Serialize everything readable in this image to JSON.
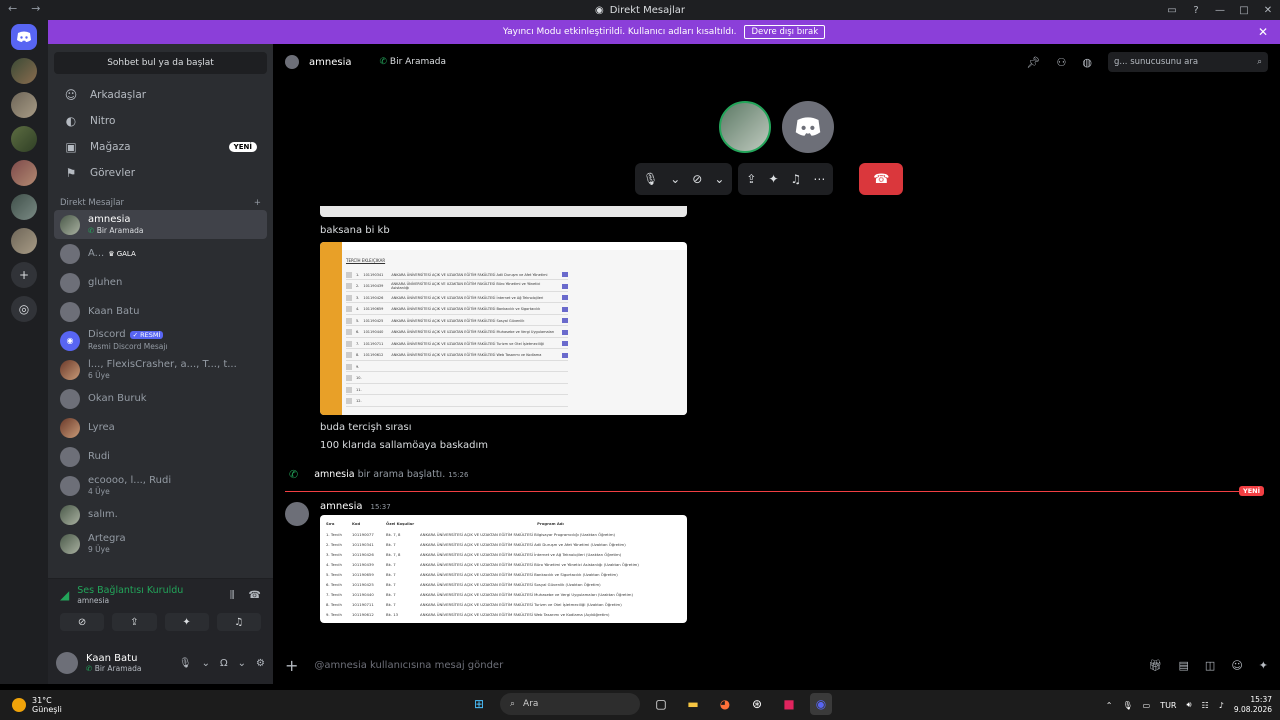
{
  "window": {
    "title": "Direkt Mesajlar",
    "nav_back": "←",
    "nav_forward": "→"
  },
  "banner": {
    "text": "Yayıncı Modu etkinleştirildi. Kullanıcı adları kısaltıldı.",
    "button": "Devre dışı bırak"
  },
  "sidebar": {
    "find_placeholder": "Sohbet bul ya da başlat",
    "nav": [
      {
        "label": "Arkadaşlar",
        "icon": "friends-icon"
      },
      {
        "label": "Nitro",
        "icon": "nitro-icon"
      },
      {
        "label": "Mağaza",
        "icon": "shop-icon",
        "badge": "YENİ"
      },
      {
        "label": "Görevler",
        "icon": "quests-icon"
      }
    ],
    "dm_header": "Direkt Mesajlar",
    "dm_add": "+",
    "dms": [
      {
        "name": "amnesia",
        "sub": "Bir Aramada"
      },
      {
        "name": "A...",
        "tag": "GALA"
      },
      {
        "name": "gluhen"
      },
      {
        "name": "Kaan Batu"
      },
      {
        "name": "Discord",
        "tag": "RESMİ",
        "sub": "Resmi Discord Mesajı"
      },
      {
        "name": "l..., FlexisCrasher, a..., T..., t...",
        "sub": "6 Üye"
      },
      {
        "name": "Okan Buruk"
      },
      {
        "name": "Lyrea"
      },
      {
        "name": "Rudi"
      },
      {
        "name": "ecoooo, l..., Rudi",
        "sub": "4 Üye"
      },
      {
        "name": "salım."
      },
      {
        "name": "Artegra",
        "sub": "9 Üye"
      }
    ]
  },
  "voice": {
    "status": "Ses Bağlantısı Kuruldu",
    "channel": "amnesia"
  },
  "user": {
    "name": "Kaan Batu",
    "status": "Bir Aramada"
  },
  "header": {
    "name": "amnesia",
    "status": "Bir Aramada",
    "search_placeholder": "g... sunucusunu ara"
  },
  "messages": {
    "line1": "baksana bi  kb",
    "line2": "buda tercişh sırası",
    "line3": "100 klarıda sallamöaya baskadım",
    "system_name": "amnesia",
    "system_text": "bir arama başlattı.",
    "system_time": "15:26",
    "new_tag": "YENİ",
    "author": "amnesia",
    "author_time": "15:37"
  },
  "attachment1": {
    "label": "TERCİH EKLE/ÇIKAR",
    "rows": [
      {
        "no": "1.",
        "code": "101190341",
        "text": "ANKARA ÜNİVERSİTESİ AÇIK VE UZAKTAN EĞİTİM FAKÜLTESİ Adli Duruşm ve Afet Yönetimi"
      },
      {
        "no": "2.",
        "code": "101190439",
        "text": "ANKARA ÜNİVERSİTESİ AÇIK VE UZAKTAN EĞİTİM FAKÜLTESİ Büro Yönetimi ve Yönetici Asistanlığı"
      },
      {
        "no": "3.",
        "code": "101190426",
        "text": "ANKARA ÜNİVERSİTESİ AÇIK VE UZAKTAN EĞİTİM FAKÜLTESİ İnternet ve Ağ Teknolojileri"
      },
      {
        "no": "4.",
        "code": "101190659",
        "text": "ANKARA ÜNİVERSİTESİ AÇIK VE UZAKTAN EĞİTİM FAKÜLTESİ Bankacılık ve Sigortacılık"
      },
      {
        "no": "5.",
        "code": "101190425",
        "text": "ANKARA ÜNİVERSİTESİ AÇIK VE UZAKTAN EĞİTİM FAKÜLTESİ Sosyal Güvenlik"
      },
      {
        "no": "6.",
        "code": "101190440",
        "text": "ANKARA ÜNİVERSİTESİ AÇIK VE UZAKTAN EĞİTİM FAKÜLTESİ Muhasebe ve Vergi Uygulamaları"
      },
      {
        "no": "7.",
        "code": "101190711",
        "text": "ANKARA ÜNİVERSİTESİ AÇIK VE UZAKTAN EĞİTİM FAKÜLTESİ Turizm ve Otel İşletmeciliği"
      },
      {
        "no": "8.",
        "code": "101190612",
        "text": "ANKARA ÜNİVERSİTESİ AÇIK VE UZAKTAN EĞİTİM FAKÜLTESİ Web Tasarımı ve Kodlama"
      },
      {
        "no": "9.",
        "code": "",
        "text": ""
      },
      {
        "no": "10.",
        "code": "",
        "text": ""
      },
      {
        "no": "11.",
        "code": "",
        "text": ""
      },
      {
        "no": "12.",
        "code": "",
        "text": ""
      }
    ]
  },
  "attachment2": {
    "headers": [
      "Sıra",
      "Kod",
      "Özel Koşullar",
      "Program Adı"
    ],
    "rows": [
      [
        "1. Tercih",
        "101190077",
        "Bk. 7, 8",
        "ANKARA ÜNİVERSİTESİ AÇIK VE UZAKTAN EĞİTİM FAKÜLTESİ Bilgisayar Programcılığı (Uzaktan Öğretim)"
      ],
      [
        "2. Tercih",
        "101190341",
        "Bk. 7",
        "ANKARA ÜNİVERSİTESİ AÇIK VE UZAKTAN EĞİTİM FAKÜLTESİ Adli Duruşm ve Afet Yönetimi (Uzaktan Öğretim)"
      ],
      [
        "3. Tercih",
        "101190426",
        "Bk. 7, 8",
        "ANKARA ÜNİVERSİTESİ AÇIK VE UZAKTAN EĞİTİM FAKÜLTESİ İnternet ve Ağ Teknolojileri (Uzaktan Öğretim)"
      ],
      [
        "4. Tercih",
        "101190439",
        "Bk. 7",
        "ANKARA ÜNİVERSİTESİ AÇIK VE UZAKTAN EĞİTİM FAKÜLTESİ Büro Yönetimi ve Yönetici Asistanlığı (Uzaktan Öğretim)"
      ],
      [
        "5. Tercih",
        "101190659",
        "Bk. 7",
        "ANKARA ÜNİVERSİTESİ AÇIK VE UZAKTAN EĞİTİM FAKÜLTESİ Bankacılık ve Sigortacılık (Uzaktan Öğretim)"
      ],
      [
        "6. Tercih",
        "101190425",
        "Bk. 7",
        "ANKARA ÜNİVERSİTESİ AÇIK VE UZAKTAN EĞİTİM FAKÜLTESİ Sosyal Güvenlik (Uzaktan Öğretim)"
      ],
      [
        "7. Tercih",
        "101190440",
        "Bk. 7",
        "ANKARA ÜNİVERSİTESİ AÇIK VE UZAKTAN EĞİTİM FAKÜLTESİ Muhasebe ve Vergi Uygulamaları (Uzaktan Öğretim)"
      ],
      [
        "8. Tercih",
        "101190711",
        "Bk. 7",
        "ANKARA ÜNİVERSİTESİ AÇIK VE UZAKTAN EĞİTİM FAKÜLTESİ Turizm ve Otel İşletmeciliği (Uzaktan Öğretim)"
      ],
      [
        "9. Tercih",
        "101190612",
        "Bk. 13",
        "ANKARA ÜNİVERSİTESİ AÇIK VE UZAKTAN EĞİTİM FAKÜLTESİ Web Tasarımı ve Kodlama (Açıköğretim)"
      ]
    ]
  },
  "composer": {
    "placeholder": "@amnesia kullanıcısına mesaj gönder"
  },
  "taskbar": {
    "temp": "31°C",
    "weather": "Güneşli",
    "search": "Ara",
    "lang": "TUR",
    "time": "15:37",
    "date": "9.08.2026"
  },
  "colors": {
    "accent": "#5865f2",
    "banner": "#8b3fd9",
    "green": "#23a55a",
    "red": "#da373c"
  }
}
